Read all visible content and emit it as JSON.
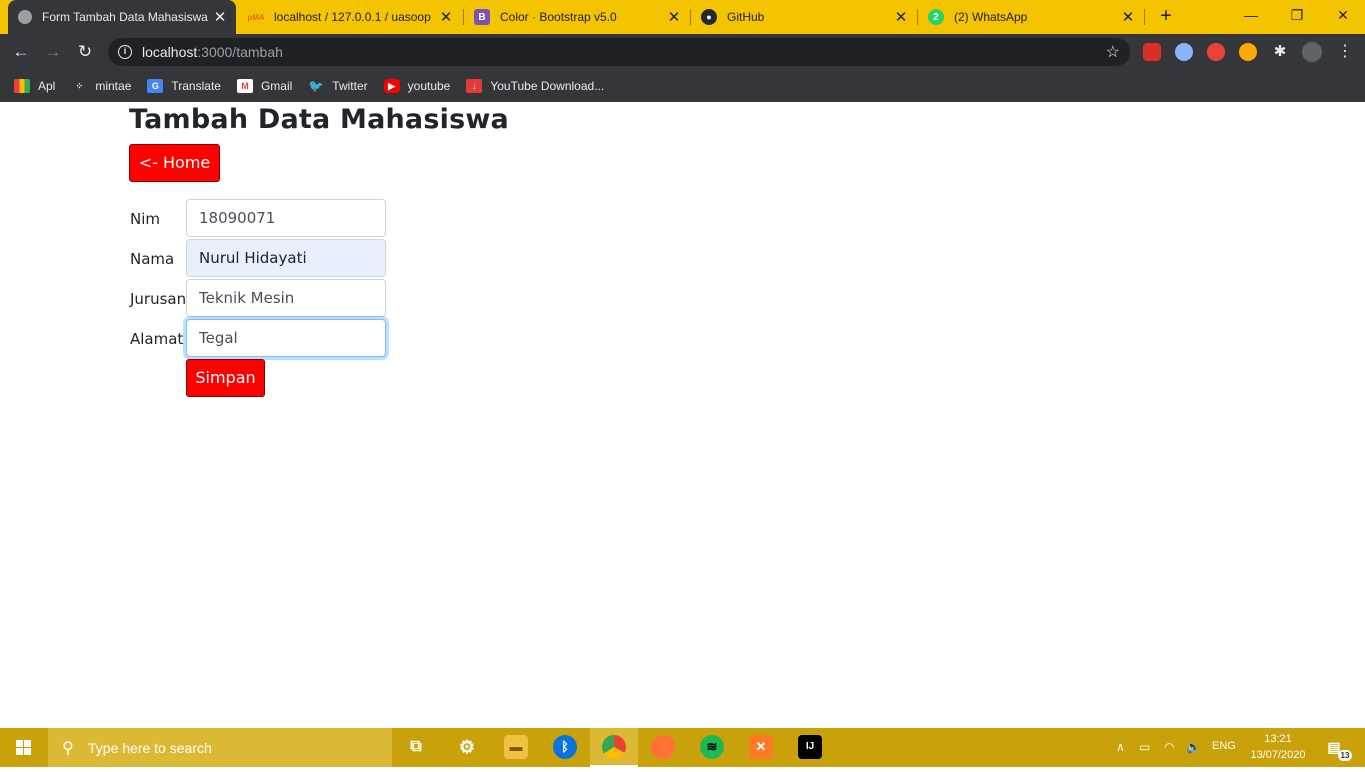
{
  "browser": {
    "tabs": [
      {
        "title": "Form Tambah Data Mahasiswa",
        "active": true
      },
      {
        "title": "localhost / 127.0.0.1 / uasoop",
        "active": false
      },
      {
        "title": "Color · Bootstrap v5.0",
        "active": false
      },
      {
        "title": "GitHub",
        "active": false
      },
      {
        "title": "(2) WhatsApp",
        "active": false
      }
    ],
    "url_host": "localhost",
    "url_path": ":3000/tambah",
    "bookmarks": [
      "Apl",
      "mintae",
      "Translate",
      "Gmail",
      "Twitter",
      "youtube",
      "YouTube Download..."
    ]
  },
  "page": {
    "title": "Tambah Data Mahasiswa",
    "home_button": "<- Home",
    "form": {
      "nim_label": "Nim",
      "nim_value": "18090071",
      "nama_label": "Nama",
      "nama_value": "Nurul Hidayati",
      "jurusan_label": "Jurusan",
      "jurusan_value": "Teknik Mesin",
      "alamat_label": "Alamat",
      "alamat_value": "Tegal",
      "submit": "Simpan"
    }
  },
  "taskbar": {
    "search_placeholder": "Type here to search",
    "lang": "ENG",
    "time": "13:21",
    "date": "13/07/2020",
    "notif_count": "13"
  },
  "colors": {
    "chrome_frame": "#f5c400",
    "toolbar": "#35363a",
    "button_red": "#ff0000",
    "taskbar": "#c9a10a"
  }
}
